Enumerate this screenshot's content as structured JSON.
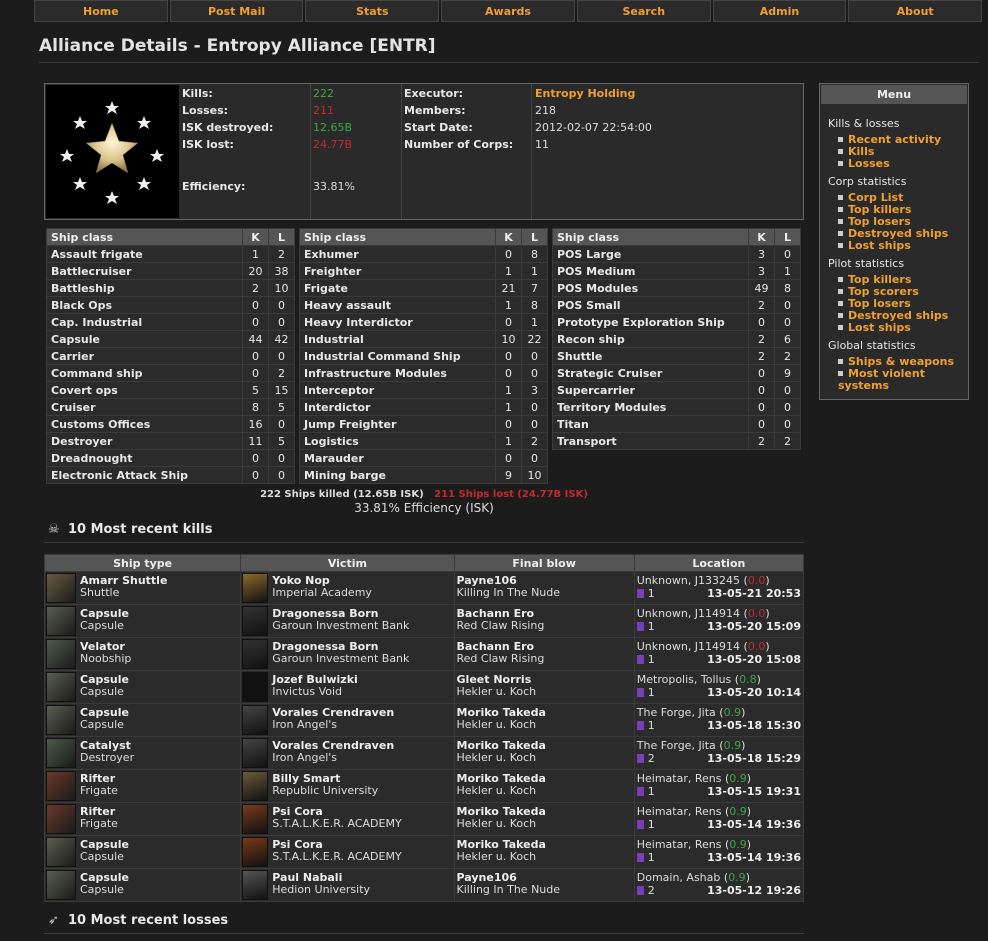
{
  "nav": [
    "Home",
    "Post Mail",
    "Stats",
    "Awards",
    "Search",
    "Admin",
    "About"
  ],
  "page_title": "Alliance Details - Entropy Alliance [ENTR]",
  "summary": {
    "kills_label": "Kills:",
    "kills": "222",
    "losses_label": "Losses:",
    "losses": "211",
    "isk_destroyed_label": "ISK destroyed:",
    "isk_destroyed": "12.65B",
    "isk_lost_label": "ISK lost:",
    "isk_lost": "24.77B",
    "efficiency_label": "Efficiency:",
    "efficiency": "33.81%",
    "executor_label": "Executor:",
    "executor": "Entropy Holding",
    "members_label": "Members:",
    "members": "218",
    "start_label": "Start Date:",
    "start": "2012-02-07 22:54:00",
    "corps_label": "Number of Corps:",
    "corps": "11"
  },
  "ship_header": {
    "class": "Ship class",
    "k": "K",
    "l": "L"
  },
  "ship_tables": [
    [
      [
        "Assault frigate",
        "1",
        "2"
      ],
      [
        "Battlecruiser",
        "20",
        "38"
      ],
      [
        "Battleship",
        "2",
        "10"
      ],
      [
        "Black Ops",
        "0",
        "0"
      ],
      [
        "Cap. Industrial",
        "0",
        "0"
      ],
      [
        "Capsule",
        "44",
        "42"
      ],
      [
        "Carrier",
        "0",
        "0"
      ],
      [
        "Command ship",
        "0",
        "2"
      ],
      [
        "Covert ops",
        "5",
        "15"
      ],
      [
        "Cruiser",
        "8",
        "5"
      ],
      [
        "Customs Offices",
        "16",
        "0"
      ],
      [
        "Destroyer",
        "11",
        "5"
      ],
      [
        "Dreadnought",
        "0",
        "0"
      ],
      [
        "Electronic Attack Ship",
        "0",
        "0"
      ]
    ],
    [
      [
        "Exhumer",
        "0",
        "8"
      ],
      [
        "Freighter",
        "1",
        "1"
      ],
      [
        "Frigate",
        "21",
        "7"
      ],
      [
        "Heavy assault",
        "1",
        "8"
      ],
      [
        "Heavy Interdictor",
        "0",
        "1"
      ],
      [
        "Industrial",
        "10",
        "22"
      ],
      [
        "Industrial Command Ship",
        "0",
        "0"
      ],
      [
        "Infrastructure Modules",
        "0",
        "0"
      ],
      [
        "Interceptor",
        "1",
        "3"
      ],
      [
        "Interdictor",
        "1",
        "0"
      ],
      [
        "Jump Freighter",
        "0",
        "0"
      ],
      [
        "Logistics",
        "1",
        "2"
      ],
      [
        "Marauder",
        "0",
        "0"
      ],
      [
        "Mining barge",
        "9",
        "10"
      ]
    ],
    [
      [
        "POS Large",
        "3",
        "0"
      ],
      [
        "POS Medium",
        "3",
        "1"
      ],
      [
        "POS Modules",
        "49",
        "8"
      ],
      [
        "POS Small",
        "2",
        "0"
      ],
      [
        "Prototype Exploration Ship",
        "0",
        "0"
      ],
      [
        "Recon ship",
        "2",
        "6"
      ],
      [
        "Shuttle",
        "2",
        "2"
      ],
      [
        "Strategic Cruiser",
        "0",
        "9"
      ],
      [
        "Supercarrier",
        "0",
        "0"
      ],
      [
        "Territory Modules",
        "0",
        "0"
      ],
      [
        "Titan",
        "0",
        "0"
      ],
      [
        "Transport",
        "2",
        "2"
      ]
    ]
  ],
  "ships_killed": "222 Ships killed (12.65B ISK)",
  "ships_lost": "211 Ships lost (24.77B ISK)",
  "efficiency_isk": "33.81% Efficiency (ISK)",
  "recent_kills_title": "10 Most recent kills",
  "recent_losses_title": "10 Most recent losses",
  "kill_headers": [
    "Ship type",
    "Victim",
    "Final blow",
    "Location"
  ],
  "kills": [
    {
      "ship": "Amarr Shuttle",
      "cls": "Shuttle",
      "victim": "Yoko Nop",
      "vcorp": "Imperial Academy",
      "fb": "Payne106",
      "fbcorp": "Killing In The Nude",
      "loc": "Unknown, J133245",
      "sec": "0.0",
      "inv": "1",
      "time": "13-05-21 20:53",
      "shipc": "#6b5a44",
      "vc": "#8a6a2a"
    },
    {
      "ship": "Capsule",
      "cls": "Capsule",
      "victim": "Dragonessa Born",
      "vcorp": "Garoun Investment Bank",
      "fb": "Bachann Ero",
      "fbcorp": "Red Claw Rising",
      "loc": "Unknown, J114914",
      "sec": "0.0",
      "inv": "1",
      "time": "13-05-20 15:09",
      "shipc": "#5a5e50",
      "vc": "#333"
    },
    {
      "ship": "Velator",
      "cls": "Noobship",
      "victim": "Dragonessa Born",
      "vcorp": "Garoun Investment Bank",
      "fb": "Bachann Ero",
      "fbcorp": "Red Claw Rising",
      "loc": "Unknown, J114914",
      "sec": "0.0",
      "inv": "1",
      "time": "13-05-20 15:08",
      "shipc": "#505a50",
      "vc": "#333"
    },
    {
      "ship": "Capsule",
      "cls": "Capsule",
      "victim": "Jozef Bulwizki",
      "vcorp": "Invictus Void",
      "fb": "Gleet Norris",
      "fbcorp": "Hekler u. Koch",
      "loc": "Metropolis, Tollus",
      "sec": "0.8",
      "inv": "1",
      "time": "13-05-20 10:14",
      "shipc": "#5a5e50",
      "vc": "#111"
    },
    {
      "ship": "Capsule",
      "cls": "Capsule",
      "victim": "Vorales Crendraven",
      "vcorp": "Iron Angel's",
      "fb": "Moriko Takeda",
      "fbcorp": "Hekler u. Koch",
      "loc": "The Forge, Jita",
      "sec": "0.9",
      "inv": "1",
      "time": "13-05-18 15:30",
      "shipc": "#5a5e50",
      "vc": "#444"
    },
    {
      "ship": "Catalyst",
      "cls": "Destroyer",
      "victim": "Vorales Crendraven",
      "vcorp": "Iron Angel's",
      "fb": "Moriko Takeda",
      "fbcorp": "Hekler u. Koch",
      "loc": "The Forge, Jita",
      "sec": "0.9",
      "inv": "2",
      "time": "13-05-18 15:29",
      "shipc": "#4a5a4a",
      "vc": "#444"
    },
    {
      "ship": "Rifter",
      "cls": "Frigate",
      "victim": "Billy Smart",
      "vcorp": "Republic University",
      "fb": "Moriko Takeda",
      "fbcorp": "Hekler u. Koch",
      "loc": "Heimatar, Rens",
      "sec": "0.9",
      "inv": "1",
      "time": "13-05-15 19:31",
      "shipc": "#6a3a2a",
      "vc": "#6a5a3a"
    },
    {
      "ship": "Rifter",
      "cls": "Frigate",
      "victim": "Psi Cora",
      "vcorp": "S.T.A.L.K.E.R. ACADEMY",
      "fb": "Moriko Takeda",
      "fbcorp": "Hekler u. Koch",
      "loc": "Heimatar, Rens",
      "sec": "0.9",
      "inv": "1",
      "time": "13-05-14 19:36",
      "shipc": "#6a3a2a",
      "vc": "#7a3a1a"
    },
    {
      "ship": "Capsule",
      "cls": "Capsule",
      "victim": "Psi Cora",
      "vcorp": "S.T.A.L.K.E.R. ACADEMY",
      "fb": "Moriko Takeda",
      "fbcorp": "Hekler u. Koch",
      "loc": "Heimatar, Rens",
      "sec": "0.9",
      "inv": "1",
      "time": "13-05-14 19:36",
      "shipc": "#5a5e50",
      "vc": "#7a3a1a"
    },
    {
      "ship": "Capsule",
      "cls": "Capsule",
      "victim": "Paul Nabali",
      "vcorp": "Hedion University",
      "fb": "Payne106",
      "fbcorp": "Killing In The Nude",
      "loc": "Domain, Ashab",
      "sec": "0.9",
      "inv": "2",
      "time": "13-05-12 19:26",
      "shipc": "#5a5e50",
      "vc": "#555"
    }
  ],
  "menu": {
    "title": "Menu",
    "sections": [
      {
        "h": "Kills & losses",
        "items": [
          "Recent activity",
          "Kills",
          "Losses"
        ]
      },
      {
        "h": "Corp statistics",
        "items": [
          "Corp List",
          "Top killers",
          "Top losers",
          "Destroyed ships",
          "Lost ships"
        ]
      },
      {
        "h": "Pilot statistics",
        "items": [
          "Top killers",
          "Top scorers",
          "Top losers",
          "Destroyed ships",
          "Lost ships"
        ]
      },
      {
        "h": "Global statistics",
        "items": [
          "Ships & weapons",
          "Most violent systems"
        ]
      }
    ]
  },
  "colors": {
    "accent": "#f0a030",
    "kill": "#3ea83e",
    "loss": "#c42a2a"
  }
}
